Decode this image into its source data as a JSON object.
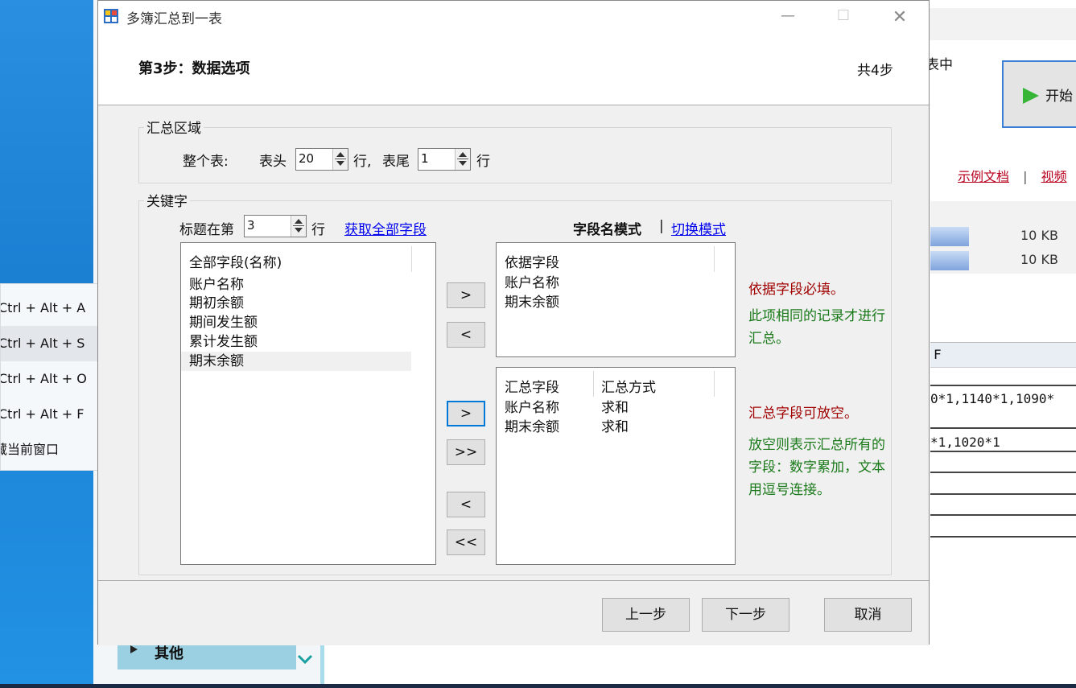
{
  "background": {
    "partial_text_top": "表中",
    "start_button_label": "开始",
    "links": {
      "doc": "示例文档",
      "separator": "|",
      "video": "视频"
    },
    "files": [
      {
        "size": "10 KB"
      },
      {
        "size": "10 KB"
      }
    ],
    "sheet": {
      "col_header": "F",
      "cell1": "0*1,1140*1,1090*",
      "cell2": "*1,1020*1"
    },
    "sidebar_item": "其他"
  },
  "context_menu": {
    "items": [
      "Ctrl + Alt + A",
      "Ctrl + Alt + S",
      "Ctrl + Alt + O",
      "Ctrl + Alt + F",
      "藏当前窗口"
    ]
  },
  "dialog": {
    "title": "多簿汇总到一表",
    "step_title": "第3步：数据选项",
    "step_count": "共4步",
    "summary_area": {
      "title": "汇总区域",
      "whole_table_label": "整个表:",
      "header_label": "表头",
      "header_value": "20",
      "row_unit": "行,",
      "footer_label": "表尾",
      "footer_value": "1",
      "row_unit2": "行"
    },
    "keywords": {
      "title": "关键字",
      "title_row_label": "标题在第",
      "title_row_value": "3",
      "title_row_unit": "行",
      "fetch_all_link": "获取全部字段",
      "mode_label": "字段名模式",
      "mode_separator": "|",
      "switch_mode_link": "切换模式",
      "all_fields": {
        "header": "全部字段(名称)",
        "items": [
          "账户名称",
          "期初余额",
          "期间发生额",
          "累计发生额",
          "期末余额"
        ]
      },
      "basis_fields": {
        "header": "依据字段",
        "items": [
          "账户名称",
          "期末余额"
        ]
      },
      "summary_fields": {
        "header_field": "汇总字段",
        "header_method": "汇总方式",
        "rows": [
          {
            "field": "账户名称",
            "method": "求和"
          },
          {
            "field": "期末余额",
            "method": "求和"
          }
        ]
      },
      "move_buttons": {
        "add": ">",
        "remove": "<",
        "add2": ">",
        "add_all": ">>",
        "remove2": "<",
        "remove_all": "<<"
      },
      "notes": {
        "basis_required": "依据字段必填。",
        "basis_desc": "此项相同的记录才进行汇总。",
        "summary_optional": "汇总字段可放空。",
        "summary_desc": "放空则表示汇总所有的字段：数字累加，文本用逗号连接。"
      }
    },
    "buttons": {
      "prev": "上一步",
      "next": "下一步",
      "cancel": "取消"
    },
    "colors": {
      "accent": "#0078d7",
      "note_red": "#a00000",
      "note_green": "#1a7a1a"
    }
  }
}
